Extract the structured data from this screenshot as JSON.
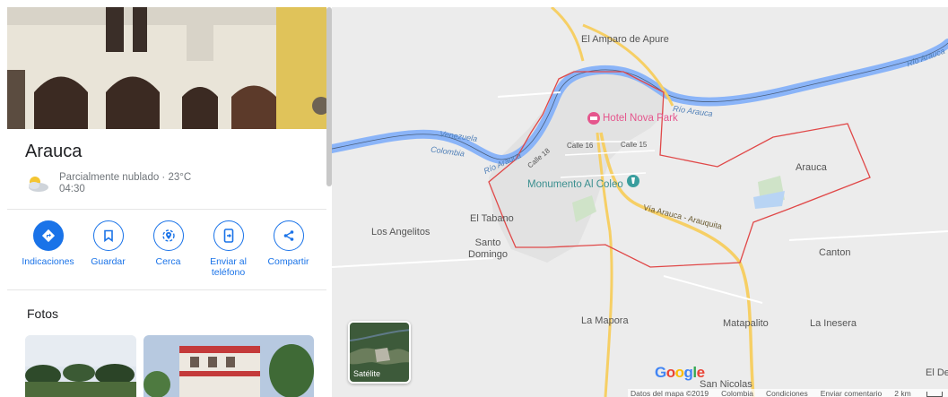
{
  "place": {
    "title": "Arauca",
    "weather": "Parcialmente nublado · 23°C",
    "time": "04:30"
  },
  "actions": [
    {
      "label": "Indicaciones",
      "icon": "directions-icon"
    },
    {
      "label": "Guardar",
      "icon": "bookmark-icon"
    },
    {
      "label": "Cerca",
      "icon": "nearby-icon"
    },
    {
      "label": "Enviar al teléfono",
      "icon": "send-to-phone-icon"
    },
    {
      "label": "Compartir",
      "icon": "share-icon"
    }
  ],
  "photos": {
    "title": "Fotos"
  },
  "map": {
    "labels": {
      "amparo": "El Amparo de Apure",
      "venezuela": "Venezuela",
      "colombia": "Colombia",
      "rio_arauca_1": "Río Arauca",
      "rio_arauca_2": "Río Arauca",
      "rio_arauca_3": "Río Arauca",
      "hotel": "Hotel Nova Park",
      "calle16": "Calle 16",
      "calle15": "Calle 15",
      "calle18": "Calle 18",
      "monumento": "Monumento Al Coleo",
      "arauca": "Arauca",
      "via": "Vía Arauca - Arauquita",
      "tabano": "El Tabano",
      "angelitos": "Los Angelitos",
      "santo_domingo": "Santo Domingo",
      "canton": "Canton",
      "mapora": "La Mapora",
      "matapalito": "Matapalito",
      "inesera": "La Inesera",
      "san_nicolas": "San Nicolas",
      "el_de": "El De"
    },
    "satellite_label": "Satélite",
    "footer": {
      "data": "Datos del mapa ©2019",
      "country": "Colombia",
      "terms": "Condiciones",
      "feedback": "Enviar comentario",
      "scale": "2 km"
    }
  },
  "colors": {
    "accent": "#1a73e8",
    "river": "#8ab4f8",
    "boundary": "#e04848",
    "road": "#f6cf65"
  }
}
